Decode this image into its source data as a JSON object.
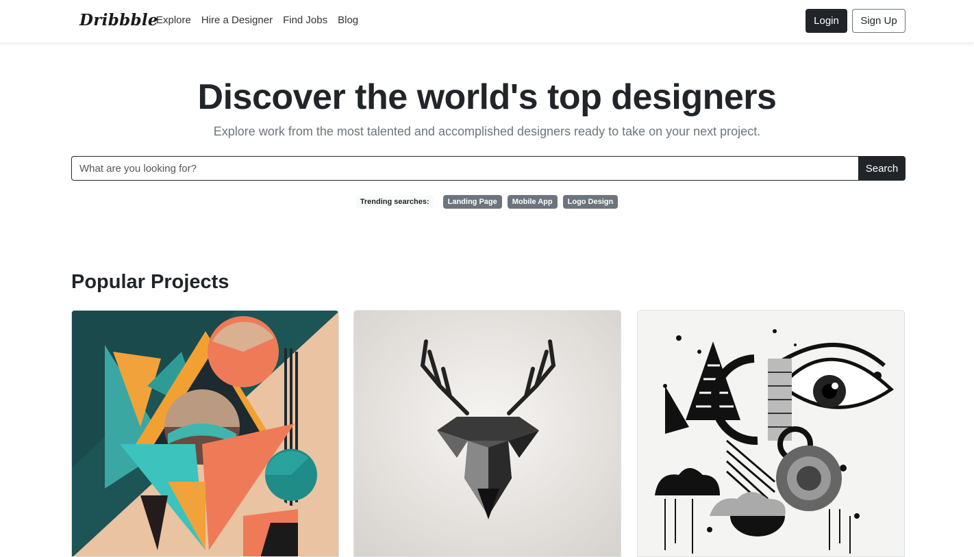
{
  "navbar": {
    "brand": "Dribbble",
    "links": [
      "Explore",
      "Hire a Designer",
      "Find Jobs",
      "Blog"
    ],
    "login_label": "Login",
    "signup_label": "Sign Up"
  },
  "hero": {
    "title": "Discover the world's top designers",
    "subtitle": "Explore work from the most talented and accomplished designers ready to take on your next project.",
    "search_placeholder": "What are you looking for?",
    "search_button": "Search"
  },
  "trending": {
    "label": "Trending searches:",
    "tags": [
      "Landing Page",
      "Mobile App",
      "Logo Design"
    ]
  },
  "projects": {
    "section_title": "Popular Projects",
    "cards": [
      {
        "icon": "abstract-geometric-artwork"
      },
      {
        "icon": "low-poly-deer-artwork"
      },
      {
        "icon": "abstract-eye-collage-artwork"
      }
    ]
  },
  "colors": {
    "dark": "#212529",
    "muted": "#6c757d",
    "teal": "#1f5a5a",
    "peach": "#e8c2a0",
    "orange": "#f0a030",
    "coral": "#ee7a5a"
  }
}
